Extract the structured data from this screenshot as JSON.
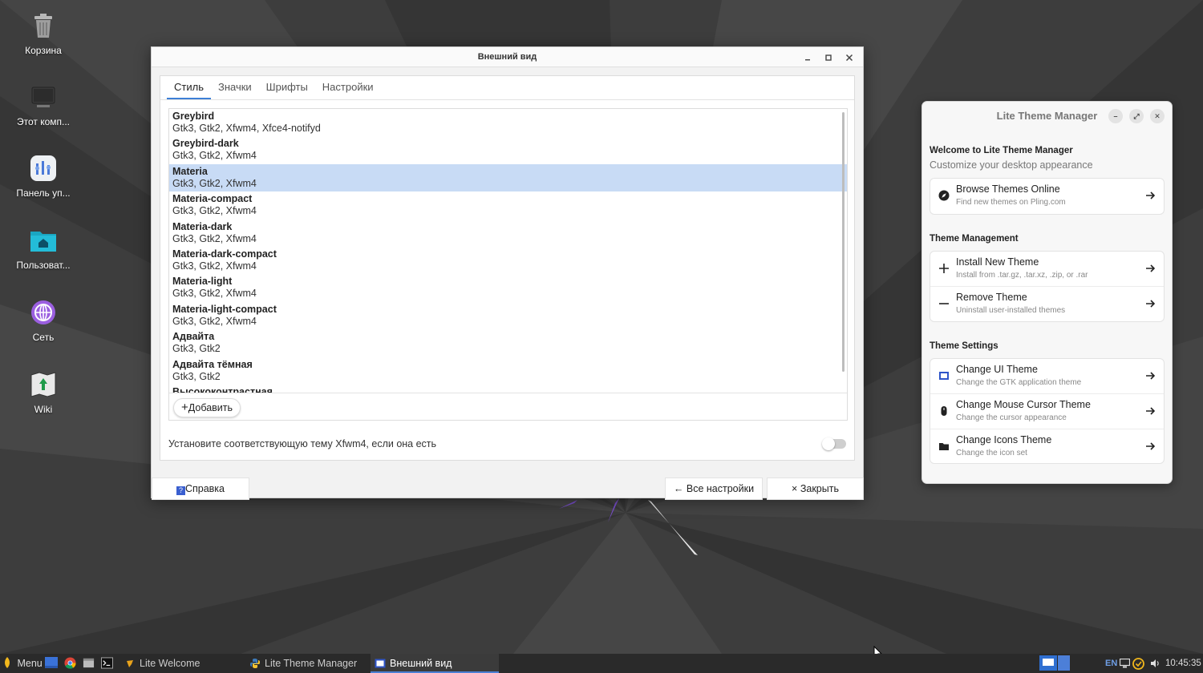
{
  "desktop": {
    "icons": [
      {
        "label": "Корзина",
        "icon": "trash-icon"
      },
      {
        "label": "Этот комп...",
        "icon": "computer-icon"
      },
      {
        "label": "Панель уп...",
        "icon": "control-panel-icon"
      },
      {
        "label": "Пользоват...",
        "icon": "home-folder-icon"
      },
      {
        "label": "Сеть",
        "icon": "network-icon"
      },
      {
        "label": "Wiki",
        "icon": "wiki-icon"
      }
    ]
  },
  "appearance": {
    "title": "Внешний вид",
    "tabs": [
      {
        "label": "Стиль",
        "active": true
      },
      {
        "label": "Значки"
      },
      {
        "label": "Шрифты"
      },
      {
        "label": "Настройки"
      }
    ],
    "themes": [
      {
        "name": "Greybird",
        "desc": "Gtk3, Gtk2, Xfwm4, Xfce4-notifyd"
      },
      {
        "name": "Greybird-dark",
        "desc": "Gtk3, Gtk2, Xfwm4"
      },
      {
        "name": "Materia",
        "desc": "Gtk3, Gtk2, Xfwm4",
        "selected": true
      },
      {
        "name": "Materia-compact",
        "desc": "Gtk3, Gtk2, Xfwm4"
      },
      {
        "name": "Materia-dark",
        "desc": "Gtk3, Gtk2, Xfwm4"
      },
      {
        "name": "Materia-dark-compact",
        "desc": "Gtk3, Gtk2, Xfwm4"
      },
      {
        "name": "Materia-light",
        "desc": "Gtk3, Gtk2, Xfwm4"
      },
      {
        "name": "Materia-light-compact",
        "desc": "Gtk3, Gtk2, Xfwm4"
      },
      {
        "name": "Адвайта",
        "desc": "Gtk3, Gtk2"
      },
      {
        "name": "Адвайта тёмная",
        "desc": "Gtk3, Gtk2"
      },
      {
        "name": "Высококонтрастная",
        "desc": ""
      }
    ],
    "add_label": "Добавить",
    "xfwm_label": "Установите соответствующую тему Xfwm4, если она есть",
    "help_label": "Справка",
    "all_settings_label": "Все настройки",
    "close_label": "Закрыть"
  },
  "theme_manager": {
    "title": "Lite Theme Manager",
    "welcome_title": "Welcome to Lite Theme Manager",
    "welcome_sub": "Customize your desktop appearance",
    "browse": {
      "title": "Browse Themes Online",
      "sub": "Find new themes on Pling.com"
    },
    "management_heading": "Theme Management",
    "install": {
      "title": "Install New Theme",
      "sub": "Install from .tar.gz, .tar.xz, .zip, or .rar"
    },
    "remove": {
      "title": "Remove Theme",
      "sub": "Uninstall user-installed themes"
    },
    "settings_heading": "Theme Settings",
    "ui_theme": {
      "title": "Change UI Theme",
      "sub": "Change the GTK application theme"
    },
    "cursor_theme": {
      "title": "Change Mouse Cursor Theme",
      "sub": "Change the cursor appearance"
    },
    "icons_theme": {
      "title": "Change Icons Theme",
      "sub": "Change the icon set"
    }
  },
  "taskbar": {
    "menu_label": "Menu",
    "apps": [
      {
        "label": "Lite Welcome"
      },
      {
        "label": "Lite Theme Manager"
      },
      {
        "label": "Внешний вид",
        "active": true
      }
    ],
    "keyboard_layout": "EN",
    "clock": "10:45:35"
  },
  "colors": {
    "selection": "#c8dbf5",
    "accent": "#3d7fd6",
    "wallpaper_accent": "#7b4fd0"
  }
}
